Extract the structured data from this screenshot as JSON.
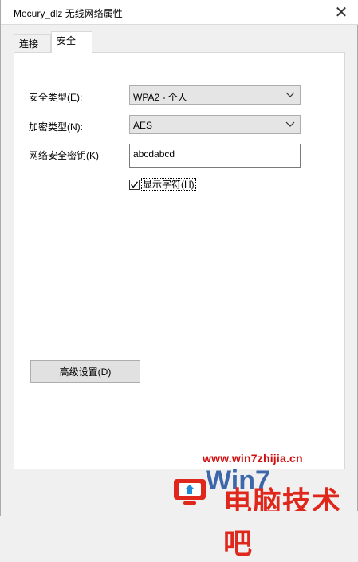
{
  "window": {
    "title": "Mecury_dlz 无线网络属性",
    "close_glyph": "✕"
  },
  "tabs": [
    {
      "label": "连接",
      "active": false
    },
    {
      "label": "安全",
      "active": true
    }
  ],
  "security": {
    "security_type_label": "安全类型(E):",
    "security_type_value": "WPA2 - 个人",
    "encryption_type_label": "加密类型(N):",
    "encryption_type_value": "AES",
    "key_label": "网络安全密钥(K)",
    "key_value": "abcdabcd",
    "show_chars_label": "显示字符(H)",
    "show_chars_checked": true,
    "advanced_button": "高级设置(D)"
  },
  "watermark": {
    "url": "www.win7zhijia.cn",
    "brand": "Win7",
    "cn_text": "电脑技术吧"
  },
  "colors": {
    "watermark_red": "#d01010",
    "watermark_blue": "#1f4fa0"
  }
}
